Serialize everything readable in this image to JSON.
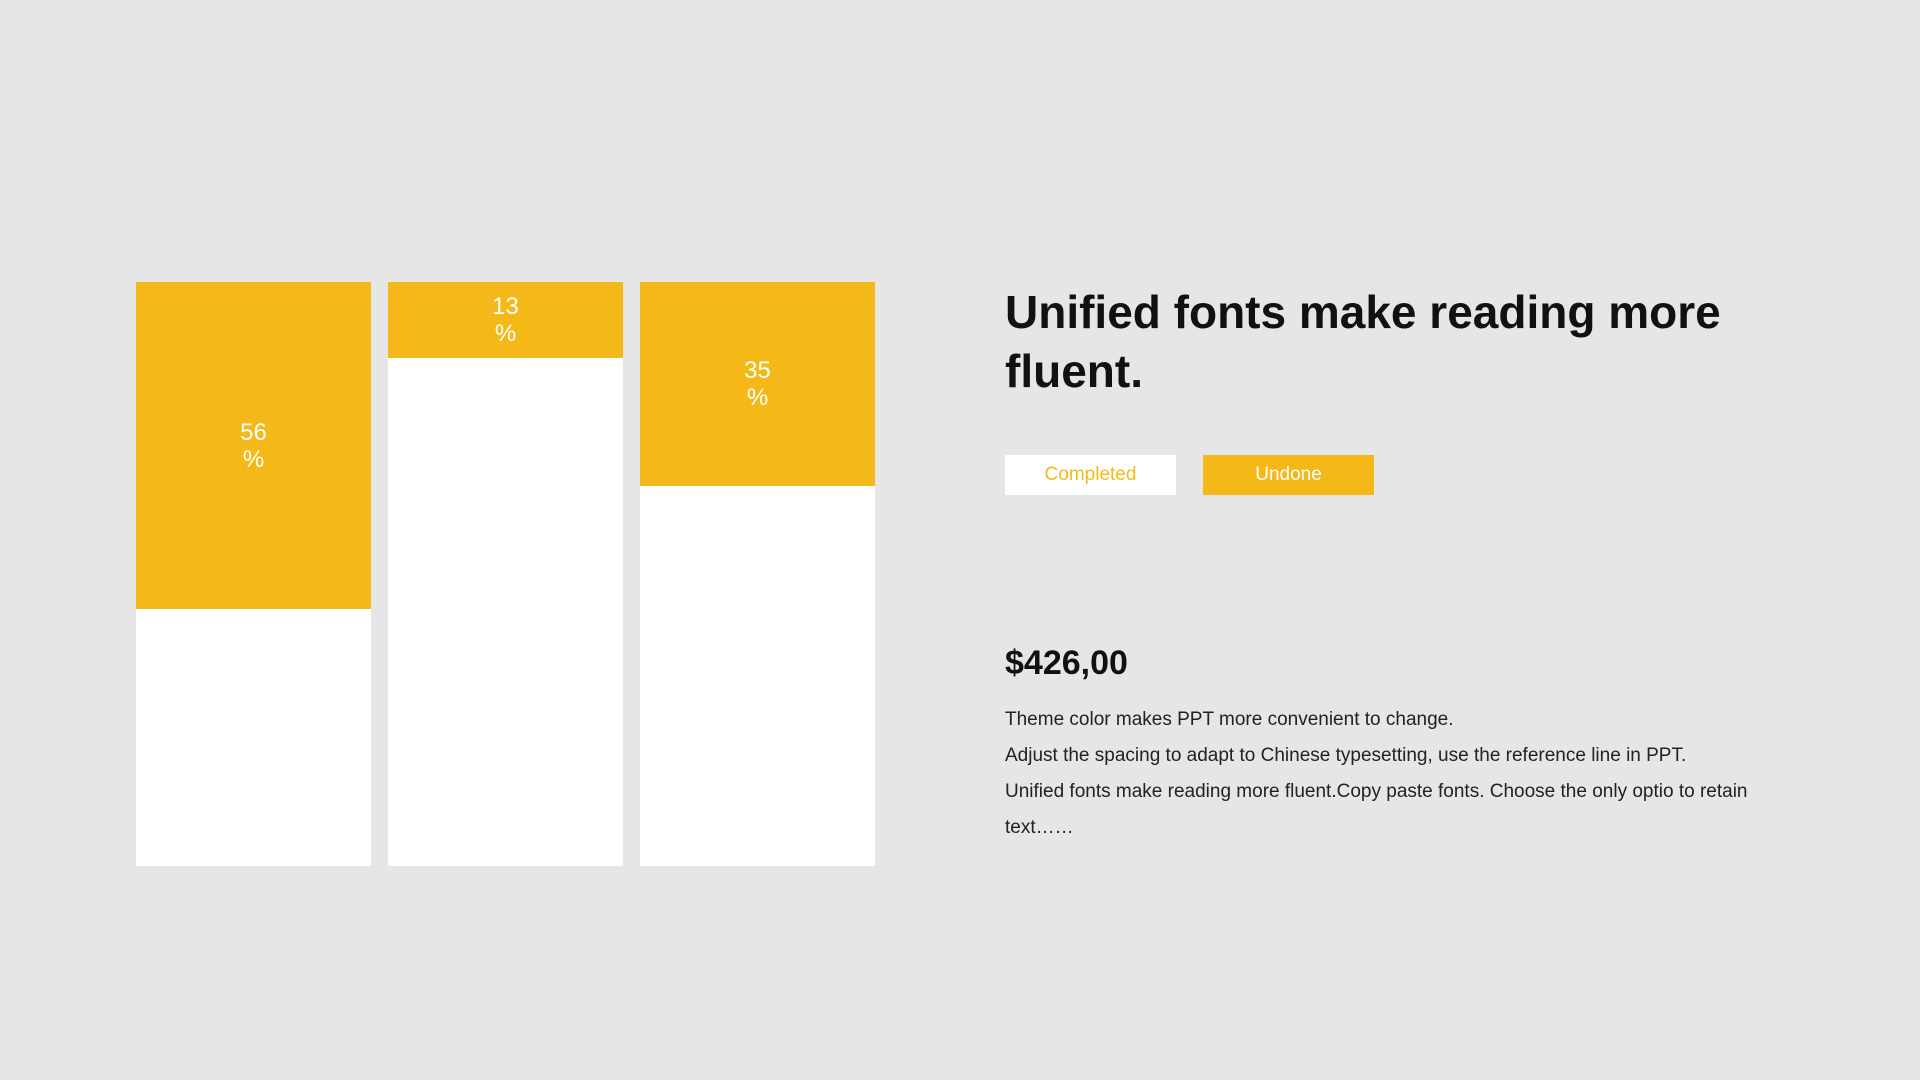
{
  "chart_data": {
    "type": "bar",
    "orientation": "vertical",
    "stacked": true,
    "values": [
      56,
      13,
      35
    ],
    "value_labels": [
      {
        "value": "56",
        "unit": "%"
      },
      {
        "value": "13",
        "unit": "%"
      },
      {
        "value": "35",
        "unit": "%"
      }
    ],
    "ylim": [
      0,
      100
    ],
    "series": [
      {
        "name": "Undone",
        "color": "#f4b919"
      },
      {
        "name": "Completed",
        "color": "#ffffff"
      }
    ],
    "grid": false,
    "legend_placement": "right"
  },
  "content": {
    "headline": "Unified fonts make reading more fluent.",
    "legend": {
      "completed_label": "Completed",
      "undone_label": "Undone"
    },
    "price": "$426,00",
    "description_lines": [
      "Theme  color makes PPT more convenient to change.",
      "Adjust the spacing to adapt to Chinese typesetting, use the reference line in PPT.",
      "Unified fonts make reading more fluent.Copy paste fonts. Choose the only optio to retain text……"
    ]
  },
  "colors": {
    "accent": "#f4b919",
    "background": "#e6e6e6",
    "panel": "#ffffff"
  }
}
